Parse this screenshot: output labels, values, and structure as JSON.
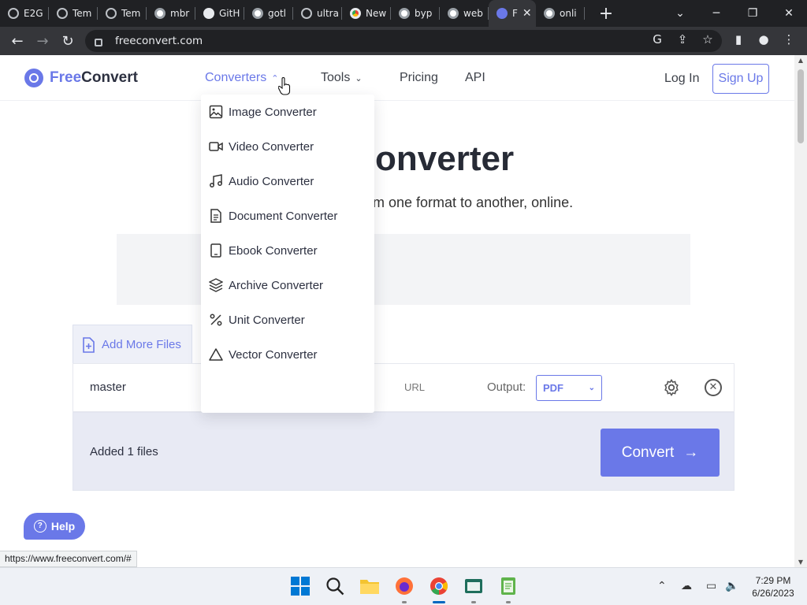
{
  "browser": {
    "tabs": [
      {
        "label": "E2G",
        "icon": "globe-icon"
      },
      {
        "label": "Tem",
        "icon": "globe-icon"
      },
      {
        "label": "Tem",
        "icon": "globe-icon"
      },
      {
        "label": "mbr",
        "icon": "google-icon"
      },
      {
        "label": "GitH",
        "icon": "github-icon"
      },
      {
        "label": "gotl",
        "icon": "google-icon"
      },
      {
        "label": "ultra",
        "icon": "globe-icon"
      },
      {
        "label": "New",
        "icon": "chrome-icon"
      },
      {
        "label": "byp",
        "icon": "google-icon"
      },
      {
        "label": "web",
        "icon": "google-icon"
      },
      {
        "label": "F",
        "icon": "freeconvert-icon",
        "active": true
      },
      {
        "label": "onli",
        "icon": "google-icon"
      }
    ],
    "address": "freeconvert.com",
    "status_url": "https://www.freeconvert.com/#"
  },
  "site": {
    "logo": {
      "free": "Free",
      "convert": "Convert"
    },
    "nav": {
      "converters": "Converters",
      "tools": "Tools",
      "pricing": "Pricing",
      "api": "API",
      "login": "Log In",
      "signup": "Sign Up"
    },
    "hero": {
      "title_visible": "onverter",
      "subtitle_visible": "m one format to another, online."
    },
    "dropdown": [
      {
        "label": "Image Converter",
        "icon": "image-icon"
      },
      {
        "label": "Video Converter",
        "icon": "video-icon"
      },
      {
        "label": "Audio Converter",
        "icon": "music-note-icon"
      },
      {
        "label": "Document Converter",
        "icon": "document-icon"
      },
      {
        "label": "Ebook Converter",
        "icon": "ebook-icon"
      },
      {
        "label": "Archive Converter",
        "icon": "layers-icon"
      },
      {
        "label": "Unit Converter",
        "icon": "percent-icon"
      },
      {
        "label": "Vector Converter",
        "icon": "triangle-icon"
      }
    ],
    "uploader": {
      "add_more": "Add More Files",
      "file_name": "master",
      "url_label": "URL",
      "output_label": "Output:",
      "output_value": "PDF",
      "added_text": "Added 1 files",
      "convert_label": "Convert"
    },
    "help": "Help"
  },
  "taskbar": {
    "time": "7:29 PM",
    "date": "6/26/2023"
  },
  "colors": {
    "accent": "#6a78e8",
    "chrome_dark": "#202124",
    "chrome_toolbar": "#35363a"
  }
}
